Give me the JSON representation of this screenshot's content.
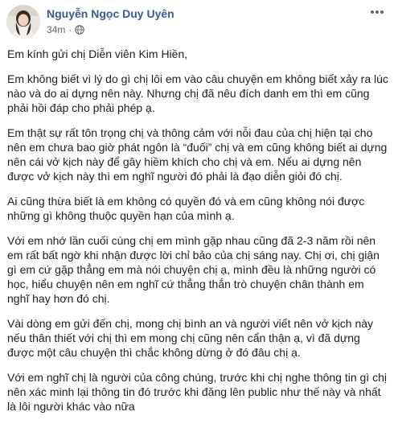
{
  "post": {
    "author": "Nguyễn Ngọc Duy Uyên",
    "time": "34m",
    "separator": "·",
    "paragraphs": [
      "Em kính gửi chị Diễn viên Kim Hiền,",
      "Em không biết vì lý do gì chị lôi em vào câu chuyện em không biết xảy ra lúc nào và do ai dựng nên này. Nhưng chị đã nêu đích danh em thì em cũng phải hồi đáp cho phải phép ạ.",
      "Em thật sự rất tôn trọng chị và thông cảm với nỗi đau của chị hiện tại cho nên em chưa bao giờ phát ngôn là “đuối” chị và em cũng không biết ai dựng nên cái vở kịch này để gây hiềm khích cho chị và em. Nếu ai dựng nên được vở kịch này thì em nghĩ người đó phải là đạo diễn giỏi đó chị.",
      "Ai cũng thừa biết là em không có quyền đó và em cũng không nói được những gì không thuộc quyền hạn của mình ạ.",
      "Với em nhớ lần cuối cùng chị em mình gặp nhau cũng đã 2-3 năm rồi nên em rất bất ngờ khi nhận được lời chỉ bảo của chị sáng nay. Chị ơi, chị giận gì em cứ gặp thẳng em mà nói chuyện chị ạ, mình đều là những người có học, hiểu chuyện nên em nghĩ cứ thẳng thắn trò chuyện chân thành em nghĩ hay hơn đó chị.",
      "Vài dòng em gửi đến chị, mong chị bình an và người viết nên vở kịch này nếu thân thiết với chị thì em mong chị cũng nên cẩn thận ạ, vì đã dựng được một câu chuyện thì chắc không dừng ở đó đâu chị ạ.",
      "Với em nghĩ chị là người của công chúng, trước khi chị nghe thông tin gì chị nên xác minh lại thông tin đó trước khi đăng lên public như thế này và nhất là lôi người khác vào nữa"
    ]
  },
  "icons": {
    "avatar": "profile-photo",
    "privacy": "globe-icon",
    "menu": "more-horizontal-icon"
  },
  "colors": {
    "author": "#385898",
    "text": "#1c1e21",
    "meta": "#616770"
  }
}
